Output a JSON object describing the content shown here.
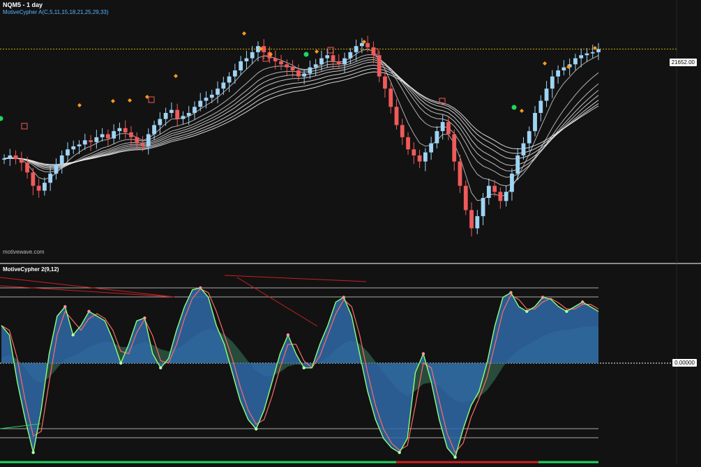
{
  "chart_title": "NQM5 - 1 day",
  "upper_indicator": "MotiveCypher A(C,5,11,15,18,21,25,29,33)",
  "watermark": "motivewave.com",
  "lower_indicator": "MotiveCypher 2(9,12)",
  "colors": {
    "background": "#121212",
    "bull_candle": "#9fd4f5",
    "bear_candle": "#f05a5a",
    "ribbon": "#ffffff",
    "signal_orange": "#ff9a1a",
    "signal_green": "#1ed760",
    "osc_fill": "#2f6aa8",
    "osc_line_fast": "#8fff7a",
    "osc_line_slow": "#ff6a6a",
    "mid_fill_pos": "#3a7a5e",
    "mid_fill_neg": "#7a2a36",
    "divergence": "#cc2020"
  },
  "chart_data": [
    {
      "type": "candlestick",
      "title": "NQM5 - 1 day",
      "last_price_label": "21652.00",
      "y_axis_labels": [
        "21652.00"
      ],
      "closes": [
        19850,
        19900,
        19840,
        19780,
        19620,
        19400,
        19320,
        19450,
        19600,
        19750,
        19900,
        20000,
        20050,
        20080,
        20150,
        20120,
        20200,
        20250,
        20180,
        20300,
        20350,
        20280,
        20200,
        20100,
        20050,
        20250,
        20400,
        20500,
        20600,
        20650,
        20500,
        20550,
        20600,
        20700,
        20800,
        20850,
        20900,
        21000,
        21100,
        21200,
        21300,
        21450,
        21500,
        21600,
        21700,
        21600,
        21500,
        21450,
        21400,
        21350,
        21300,
        21200,
        21250,
        21350,
        21400,
        21500,
        21550,
        21450,
        21400,
        21500,
        21600,
        21700,
        21750,
        21680,
        21550,
        21200,
        21000,
        20700,
        20400,
        20200,
        20000,
        19900,
        19800,
        19950,
        20100,
        20300,
        20450,
        20250,
        19800,
        19400,
        19000,
        18700,
        18900,
        19200,
        19400,
        19300,
        19150,
        19300,
        19600,
        19900,
        20100,
        20300,
        20600,
        20800,
        21000,
        21200,
        21300,
        21350,
        21400,
        21500,
        21550,
        21580,
        21600,
        21650
      ],
      "signal_markers": [
        "diamond-orange",
        "circle-green",
        "square-red-D"
      ]
    },
    {
      "type": "line",
      "title": "MotiveCypher 2(9,12)",
      "zero_label": "0.00000",
      "series": [
        {
          "values": [
            40,
            30,
            -20,
            -60,
            -95,
            -50,
            10,
            50,
            60,
            30,
            40,
            55,
            50,
            45,
            25,
            0,
            20,
            45,
            48,
            10,
            -5,
            5,
            35,
            60,
            78,
            80,
            70,
            40,
            20,
            -10,
            -40,
            -60,
            -70,
            -50,
            -20,
            10,
            30,
            10,
            -5,
            -5,
            20,
            40,
            65,
            70,
            50,
            10,
            -30,
            -60,
            -80,
            -90,
            -95,
            -80,
            -10,
            10,
            -20,
            -60,
            -90,
            -100,
            -70,
            -45,
            -30,
            0,
            40,
            70,
            75,
            60,
            55,
            60,
            70,
            68,
            60,
            55,
            60,
            65,
            60,
            55
          ]
        }
      ]
    }
  ]
}
